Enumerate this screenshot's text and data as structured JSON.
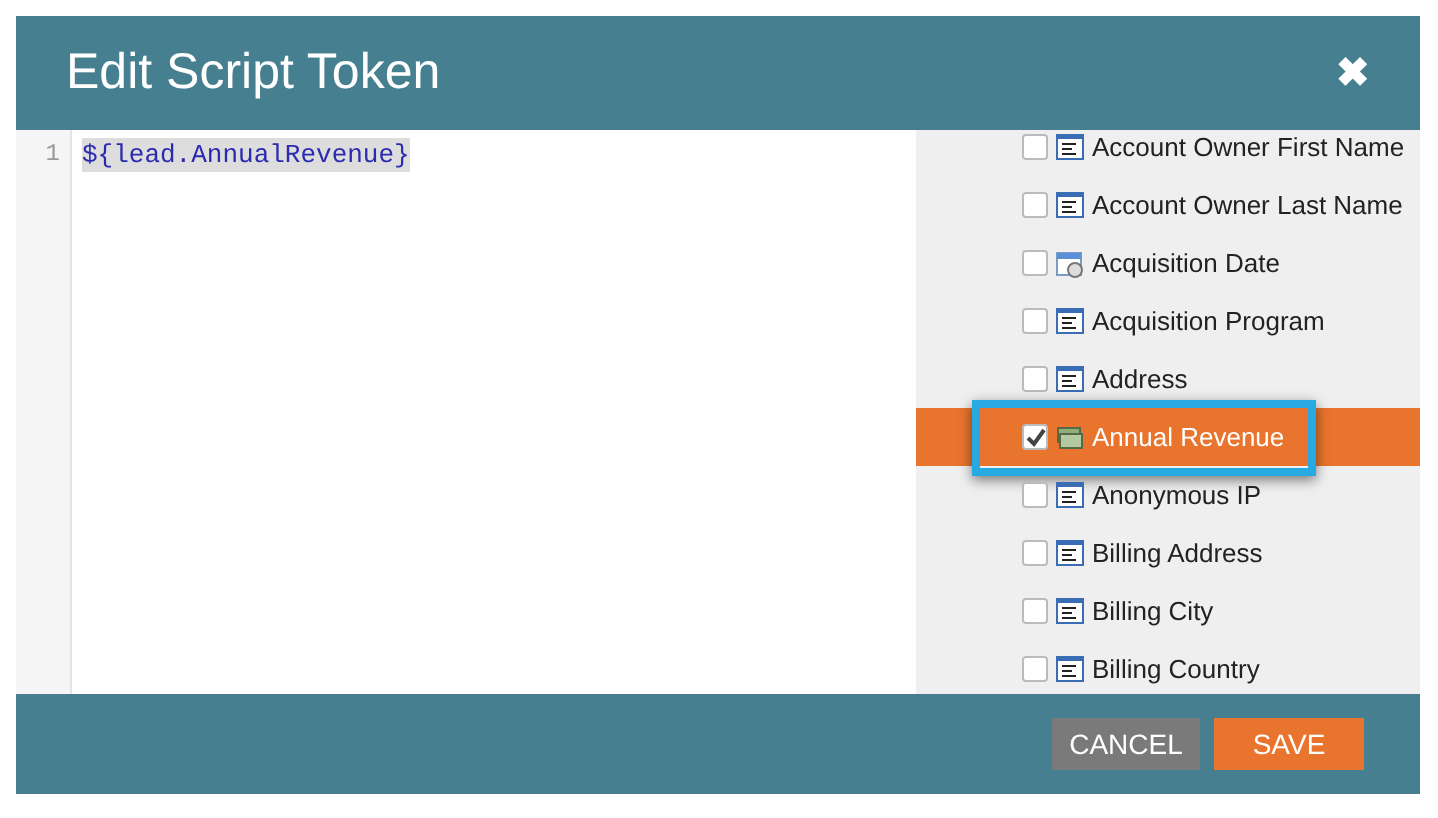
{
  "dialog": {
    "title": "Edit Script Token",
    "close": "✖"
  },
  "editor": {
    "lines": [
      {
        "number": "1",
        "code": "${lead.AnnualRevenue}"
      }
    ]
  },
  "fields": [
    {
      "label": "Account Owner First Name",
      "kind": "text",
      "checked": false,
      "selected": false
    },
    {
      "label": "Account Owner Last Name",
      "kind": "text",
      "checked": false,
      "selected": false
    },
    {
      "label": "Acquisition Date",
      "kind": "date",
      "checked": false,
      "selected": false
    },
    {
      "label": "Acquisition Program",
      "kind": "text",
      "checked": false,
      "selected": false
    },
    {
      "label": "Address",
      "kind": "text",
      "checked": false,
      "selected": false
    },
    {
      "label": "Annual Revenue",
      "kind": "currency",
      "checked": true,
      "selected": true
    },
    {
      "label": "Anonymous IP",
      "kind": "text",
      "checked": false,
      "selected": false
    },
    {
      "label": "Billing Address",
      "kind": "text",
      "checked": false,
      "selected": false
    },
    {
      "label": "Billing City",
      "kind": "text",
      "checked": false,
      "selected": false
    },
    {
      "label": "Billing Country",
      "kind": "text",
      "checked": false,
      "selected": false
    }
  ],
  "buttons": [
    {
      "label": "CANCEL",
      "kind": "secondary"
    },
    {
      "label": "SAVE",
      "kind": "primary"
    }
  ]
}
